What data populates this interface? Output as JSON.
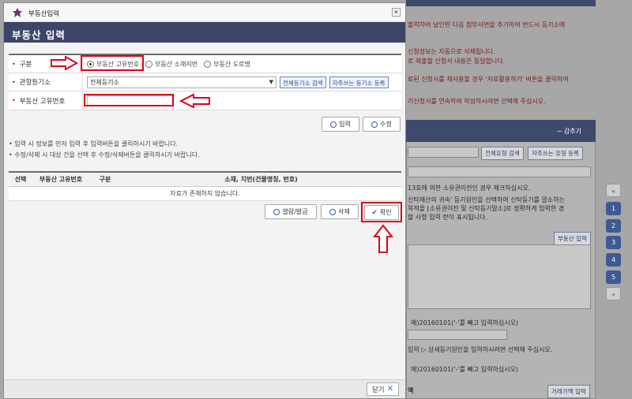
{
  "dialog": {
    "title": "부동산입력",
    "close_icon": "close-icon",
    "header": "부동산 입력"
  },
  "form": {
    "type_label": "구분",
    "type_options": [
      "부동산 고유번호",
      "부동산 소재지번",
      "부동산 도로명"
    ],
    "type_selected": "부동산 고유번호",
    "registry_label": "관할등기소",
    "registry_value": "전체등기소",
    "registry_search_btn": "전체등기소 검색",
    "registry_favorite_btn": "자주쓰는 등기소 등록",
    "unique_no_label": "부동산 고유번호",
    "unique_no_value": ""
  },
  "actions": {
    "input_btn": "입력",
    "edit_btn": "수정"
  },
  "notes": [
    "• 입력 시 정보를 먼저 입력 후 입력버튼을 클릭하시기 바랍니다.",
    "• 수정/삭제 시 대상 건을 선택 후 수정/삭제버튼을 클릭하시기 바랍니다."
  ],
  "table": {
    "headers": [
      "선택",
      "부동산 고유번호",
      "구분",
      "소재, 지번(건물명칭, 번호)"
    ],
    "empty_message": "자료가 존재하지 않습니다."
  },
  "bottom_actions": {
    "view_btn": "열람/발급",
    "delete_btn": "삭제",
    "confirm_btn": "확인"
  },
  "footer": {
    "close_btn": "닫기"
  },
  "background": {
    "line1": "출력하여 날인한 다음 첨부서면을 추가하여 반드시 등기소에",
    "line2": "신청정보는 자동으로 삭제됩니다.",
    "line3": "로 제출할 신청서 내용은 동일합니다.",
    "line4": "료된 신청서를 재사용할 경우 '자료활용하기' 버튼을 클릭하여",
    "line5": "기신청서를 연속하여 작성하시려면 선택해 주십시오.",
    "panel_toggle": "− 감추기",
    "type_search_btn": "전체유형 검색",
    "type_favorite_btn": "자주쓰는 유형 등록",
    "line6": "13호에 의한 소유권이전인 경우 체크하십시오.",
    "line7": "신탁재산의 귀속' 등기원인을 선택하여 신탁등기를 말소하는",
    "line8": "목적을 [소유권이전 및 신탁등기말소]로 정확하게 입력한 경",
    "line9": "할 사항 입력 란이 표시됩니다.",
    "realestate_input_btn": "부동산 입력",
    "line10": "예)20160101('-'를 빼고 입력하십시오)",
    "line11": "입력 ▷ 상세등기원인을 입력하시려면 선택해 주십시오.",
    "line12": "예)20160101('-'를 빼고 입력하십시오)",
    "line13": "액",
    "trade_price_btn": "거래가액 입력",
    "side_nav": [
      "«",
      "1",
      "2",
      "3",
      "4",
      "5",
      "»"
    ]
  },
  "colors": {
    "header_bg": "#3d4666",
    "highlight": "#e0001a",
    "accent": "#3a5ca8"
  }
}
